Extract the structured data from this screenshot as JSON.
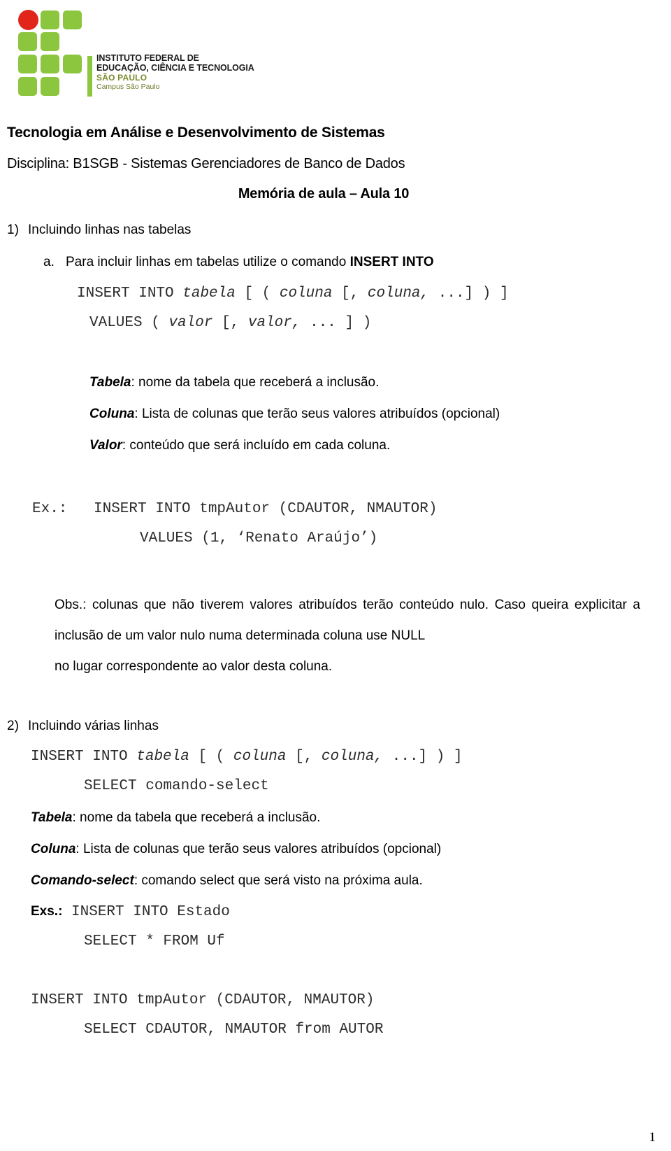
{
  "logo": {
    "line1": "INSTITUTO FEDERAL DE",
    "line2": "EDUCAÇÃO, CIÊNCIA E TECNOLOGIA",
    "line3": "SÃO PAULO",
    "line4": "Campus São Paulo",
    "green": "#8CC63F",
    "red": "#E1251B",
    "olive": "#7C8B2E"
  },
  "header": {
    "course_title": "Tecnologia em Análise e Desenvolvimento de Sistemas",
    "discipline": "Disciplina: B1SGB - Sistemas Gerenciadores de Banco de Dados",
    "memo_title": "Memória de aula – Aula 10"
  },
  "section1": {
    "number": "1)",
    "title": "Incluindo linhas nas tabelas",
    "sub_a_letter": "a.",
    "sub_a_text_before": "Para incluir linhas em tabelas utilize o comando ",
    "sub_a_text_bold": "INSERT INTO",
    "syntax_line1_kw": "INSERT INTO ",
    "syntax_line1_var1": "tabela",
    "syntax_line1_mid1": " [ ( ",
    "syntax_line1_var2": "coluna",
    "syntax_line1_mid2": " [, ",
    "syntax_line1_var3": "coluna,",
    "syntax_line1_end": " ...] ) ]",
    "syntax_line2_kw": "VALUES ( ",
    "syntax_line2_var1": "valor",
    "syntax_line2_mid1": " [, ",
    "syntax_line2_var2": "valor,",
    "syntax_line2_end": " ... ] )",
    "def_tabela_term": "Tabela",
    "def_tabela_text": ": nome da tabela que receberá a inclusão.",
    "def_coluna_term": "Coluna",
    "def_coluna_text": ": Lista de colunas que terão seus valores atribuídos (opcional)",
    "def_valor_term": "Valor",
    "def_valor_text": ": conteúdo que será incluído em cada coluna.",
    "example_label": "Ex.: ",
    "example_line1": "INSERT INTO tmpAutor (CDAUTOR, NMAUTOR)",
    "example_line2": "VALUES (1, ‘Renato Araújo’)",
    "obs_text": "Obs.: colunas que não tiverem valores atribuídos terão conteúdo nulo. Caso queira explicitar a inclusão de um valor nulo numa determinada coluna use NULL",
    "obs_last_line": "no lugar correspondente ao valor desta coluna."
  },
  "section2": {
    "number": "2)",
    "title": "Incluindo várias linhas",
    "syntax_line1_kw": "INSERT INTO ",
    "syntax_line1_var1": "tabela",
    "syntax_line1_mid1": " [ ( ",
    "syntax_line1_var2": "coluna",
    "syntax_line1_mid2": " [, ",
    "syntax_line1_var3": "coluna,",
    "syntax_line1_end": " ...] ) ]",
    "syntax_line2": "SELECT comando-select",
    "def_tabela_term": "Tabela",
    "def_tabela_text": ": nome da tabela que receberá a inclusão.",
    "def_coluna_term": "Coluna",
    "def_coluna_text": ": Lista de colunas que terão seus valores atribuídos (opcional)",
    "def_comando_term": "Comando-select",
    "def_comando_text": ": comando select que será visto na próxima aula.",
    "exs_label": "Exs.:",
    "exs_line1": " INSERT INTO Estado",
    "exs_line2": "SELECT * FROM Uf",
    "exs_line3": "INSERT INTO tmpAutor (CDAUTOR, NMAUTOR)",
    "exs_line4": "SELECT CDAUTOR, NMAUTOR from AUTOR"
  },
  "footer": {
    "page_number": "1"
  }
}
